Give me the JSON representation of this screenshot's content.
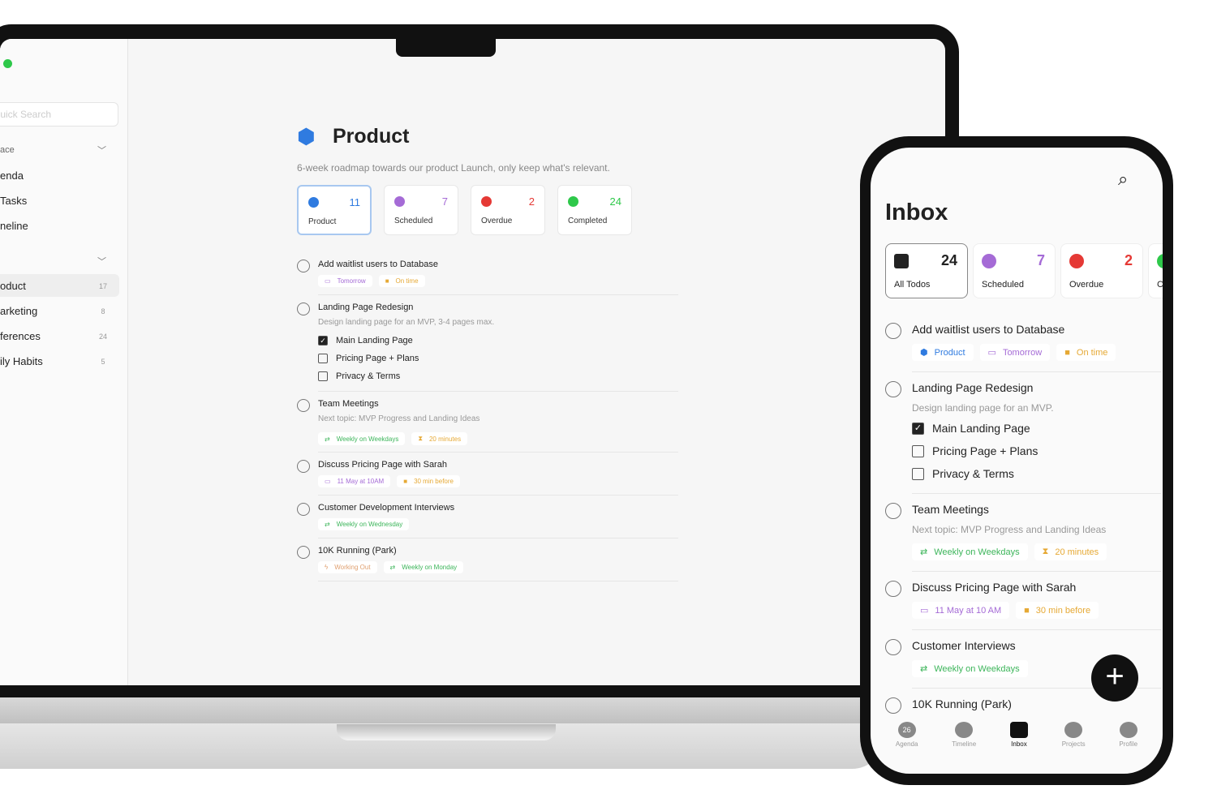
{
  "laptop": {
    "sidebar": {
      "search_placeholder": "Quick Search",
      "section1": "ace",
      "section2": "",
      "nav": [
        {
          "label": "enda"
        },
        {
          "label": " Tasks"
        },
        {
          "label": "neline"
        }
      ],
      "projects": [
        {
          "label": "oduct",
          "count": "17"
        },
        {
          "label": "arketing",
          "count": "8"
        },
        {
          "label": "ferences",
          "count": "24"
        },
        {
          "label": "ily Habits",
          "count": "5"
        }
      ]
    },
    "header": {
      "title": "Product",
      "subtitle": "6-week roadmap towards our product Launch, only keep what's relevant."
    },
    "cards": [
      {
        "label": "Product",
        "count": "11",
        "color": "#2f7be0"
      },
      {
        "label": "Scheduled",
        "count": "7",
        "color": "#a56bd6"
      },
      {
        "label": "Overdue",
        "count": "2",
        "color": "#e53935"
      },
      {
        "label": "Completed",
        "count": "24",
        "color": "#2ec84a"
      }
    ],
    "tasks": [
      {
        "title": "Add waitlist users to Database",
        "tags": [
          {
            "icon": "calendar-icon",
            "label": "Tomorrow",
            "color": "#a56bd6"
          },
          {
            "icon": "alarm-icon",
            "label": "On time",
            "color": "#e6a935"
          }
        ]
      },
      {
        "title": "Landing Page Redesign",
        "note": "Design landing page for an MVP, 3-4 pages max.",
        "subtasks": [
          {
            "label": "Main Landing Page",
            "done": true
          },
          {
            "label": "Pricing Page + Plans",
            "done": false
          },
          {
            "label": "Privacy & Terms",
            "done": false
          }
        ]
      },
      {
        "title": "Team Meetings",
        "note": "Next topic: MVP Progress and Landing Ideas",
        "tags": [
          {
            "icon": "repeat-icon",
            "label": "Weekly on Weekdays",
            "color": "#3cb55a"
          },
          {
            "icon": "hourglass-icon",
            "label": "20 minutes",
            "color": "#e6a935"
          }
        ]
      },
      {
        "title": "Discuss Pricing Page with Sarah",
        "tags": [
          {
            "icon": "calendar-icon",
            "label": "11 May at 10AM",
            "color": "#a56bd6"
          },
          {
            "icon": "alarm-icon",
            "label": "30 min before",
            "color": "#e6a935"
          }
        ]
      },
      {
        "title": "Customer Development Interviews",
        "tags": [
          {
            "icon": "repeat-icon",
            "label": "Weekly on Wednesday",
            "color": "#3cb55a"
          }
        ]
      },
      {
        "title": "10K Running (Park)",
        "tags": [
          {
            "icon": "bolt-icon",
            "label": "Working Out",
            "color": "#e0a070"
          },
          {
            "icon": "repeat-icon",
            "label": "Weekly on Monday",
            "color": "#3cb55a"
          }
        ]
      }
    ]
  },
  "phone": {
    "title": "Inbox",
    "cards": [
      {
        "label": "All Todos",
        "count": "24",
        "color": "#222"
      },
      {
        "label": "Scheduled",
        "count": "7",
        "color": "#a56bd6"
      },
      {
        "label": "Overdue",
        "count": "2",
        "color": "#e53935"
      },
      {
        "label": "C",
        "count": "",
        "color": "#2ec84a"
      }
    ],
    "tasks": [
      {
        "title": "Add waitlist users to Database",
        "tags": [
          {
            "icon": "cube-icon",
            "label": "Product",
            "color": "#2f7be0"
          },
          {
            "icon": "calendar-icon",
            "label": "Tomorrow",
            "color": "#a56bd6"
          },
          {
            "icon": "alarm-icon",
            "label": "On time",
            "color": "#e6a935"
          }
        ]
      },
      {
        "title": "Landing Page Redesign",
        "note": "Design landing page for an MVP.",
        "subtasks": [
          {
            "label": "Main Landing Page",
            "done": true
          },
          {
            "label": "Pricing Page + Plans",
            "done": false
          },
          {
            "label": "Privacy & Terms",
            "done": false
          }
        ]
      },
      {
        "title": "Team Meetings",
        "note": "Next topic: MVP Progress and Landing Ideas",
        "tags": [
          {
            "icon": "repeat-icon",
            "label": "Weekly on Weekdays",
            "color": "#3cb55a"
          },
          {
            "icon": "hourglass-icon",
            "label": "20 minutes",
            "color": "#e6a935"
          }
        ]
      },
      {
        "title": "Discuss Pricing Page with Sarah",
        "tags": [
          {
            "icon": "calendar-icon",
            "label": "11 May at 10 AM",
            "color": "#a56bd6"
          },
          {
            "icon": "alarm-icon",
            "label": "30 min before",
            "color": "#e6a935"
          }
        ]
      },
      {
        "title": "Customer Interviews",
        "tags": [
          {
            "icon": "repeat-icon",
            "label": "Weekly on Weekdays",
            "color": "#3cb55a"
          }
        ]
      },
      {
        "title": "10K Running (Park)"
      }
    ],
    "tabs": [
      {
        "label": "Agenda",
        "badge": "26"
      },
      {
        "label": "Timeline"
      },
      {
        "label": "Inbox",
        "active": true
      },
      {
        "label": "Projects"
      },
      {
        "label": "Profile"
      }
    ]
  }
}
